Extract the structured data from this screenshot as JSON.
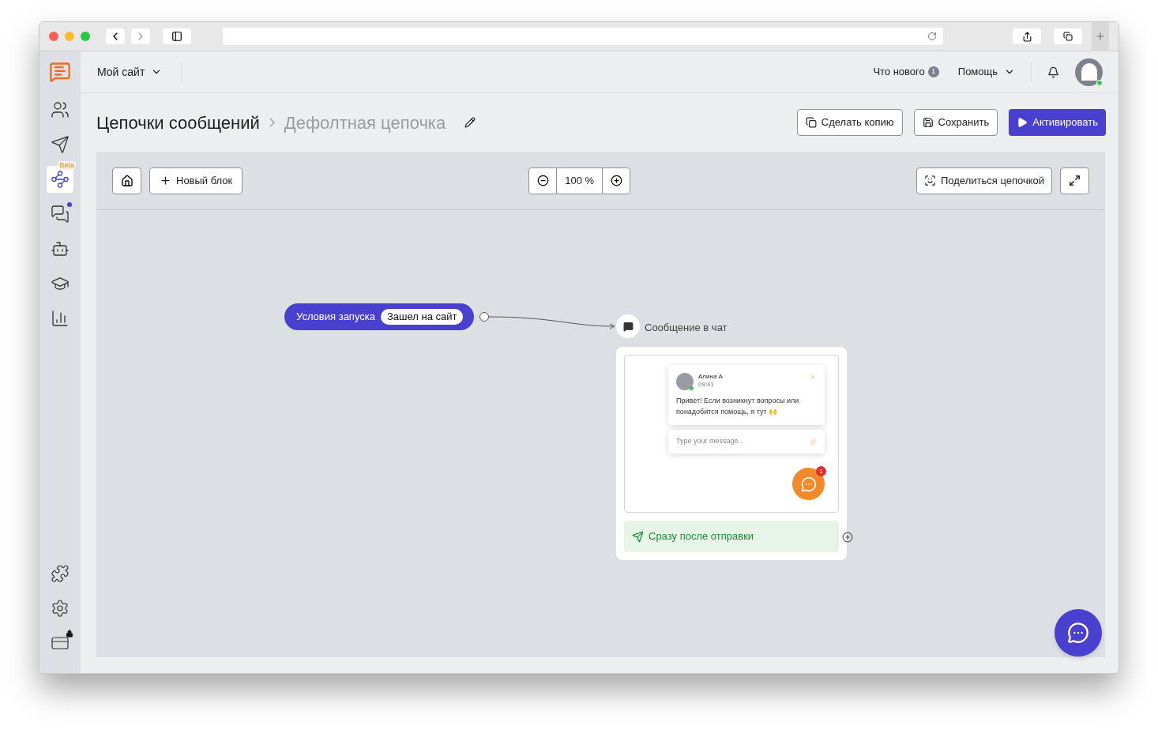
{
  "sidebar": {
    "items": [
      {
        "selected": false
      },
      {
        "selected": false
      },
      {
        "selected": true,
        "badge": "Beta"
      },
      {
        "selected": false,
        "unread": true
      },
      {
        "selected": false
      },
      {
        "selected": false
      },
      {
        "selected": false
      }
    ],
    "bottom_items": [
      {
        "locked": false
      },
      {
        "locked": false
      },
      {
        "locked": true
      }
    ]
  },
  "header": {
    "site": "Мой сайт",
    "whats_new": "Что нового",
    "whats_new_count": "1",
    "help": "Помощь",
    "avatar_online": true
  },
  "title": {
    "section": "Цепочки сообщений",
    "chain": "Дефолтная цепочка"
  },
  "actions": [
    {
      "kind": "copy",
      "label": "Сделать копию",
      "primary": false
    },
    {
      "kind": "save",
      "label": "Сохранить",
      "primary": false
    },
    {
      "kind": "play",
      "label": "Активировать",
      "primary": true
    }
  ],
  "toolbar": {
    "new_block": "Новый блок",
    "zoom": "100 %",
    "share": "Поделиться цепочкой"
  },
  "canvas": {
    "trigger": {
      "label": "Условия запуска",
      "value": "Зашел на сайт"
    },
    "message_node": {
      "title": "Сообщение в чат",
      "preview": {
        "name": "Алина А",
        "time": "09:41",
        "text": "Привет! Если возникнут вопросы или понадобится помощь, я тут 🙌",
        "placeholder": "Type your message...",
        "count": "1"
      },
      "footer": "Сразу после отправки"
    }
  }
}
